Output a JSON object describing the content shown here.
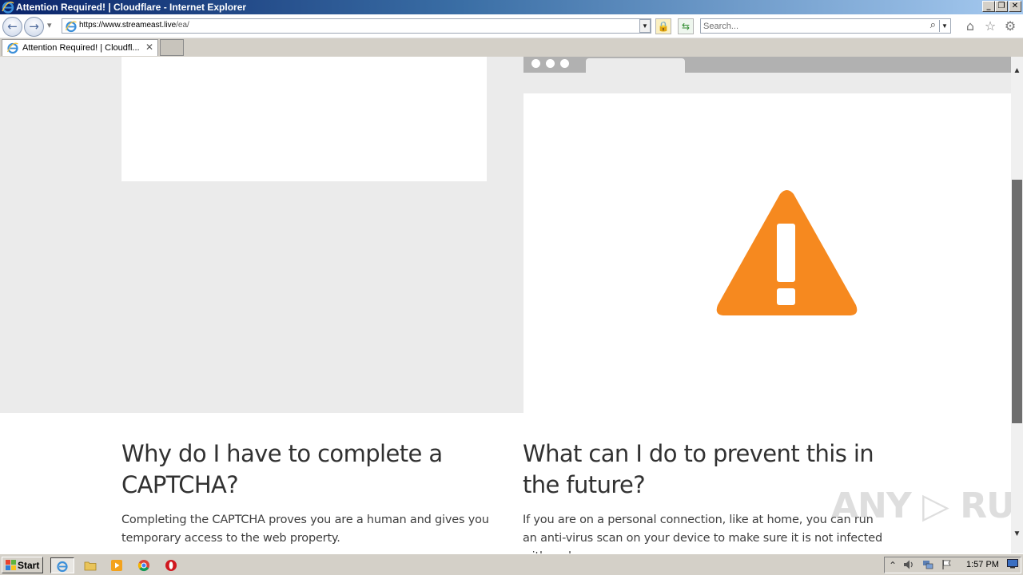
{
  "window": {
    "title": "Attention Required! | Cloudflare - Internet Explorer",
    "minimize": "_",
    "restore": "❐",
    "close": "✕"
  },
  "navbar": {
    "back": "←",
    "forward": "→",
    "history_dropdown": "▾",
    "url_host": "https://www.streameast.live",
    "url_path": "/ea/",
    "address_dropdown": "▼",
    "lock": "🔒",
    "refresh": "⇆",
    "search_placeholder": "Search...",
    "search_icon": "⌕",
    "search_dropdown": "▼",
    "home_icon": "⌂",
    "favorites_icon": "☆",
    "tools_icon": "⚙"
  },
  "tabs": [
    {
      "label": "Attention Required! | Cloudfl...",
      "close": "✕"
    }
  ],
  "page": {
    "why_heading": "Why do I have to complete a CAPTCHA?",
    "why_text": "Completing the CAPTCHA proves you are a human and gives you temporary access to the web property.",
    "prevent_heading": "What can I do to prevent this in the future?",
    "prevent_text": "If you are on a personal connection, like at home, you can run an anti-virus scan on your device to make sure it is not infected with malware.",
    "warning_color": "#f6891f"
  },
  "watermark": "ANY ▷ RUN",
  "scrollbar": {
    "up": "▲",
    "down": "▼"
  },
  "taskbar": {
    "start_label": "Start",
    "apps": [
      "internet-explorer",
      "file-explorer",
      "media-player",
      "chrome",
      "opera"
    ],
    "tray_expand": "⌃",
    "clock": "1:57 PM"
  }
}
